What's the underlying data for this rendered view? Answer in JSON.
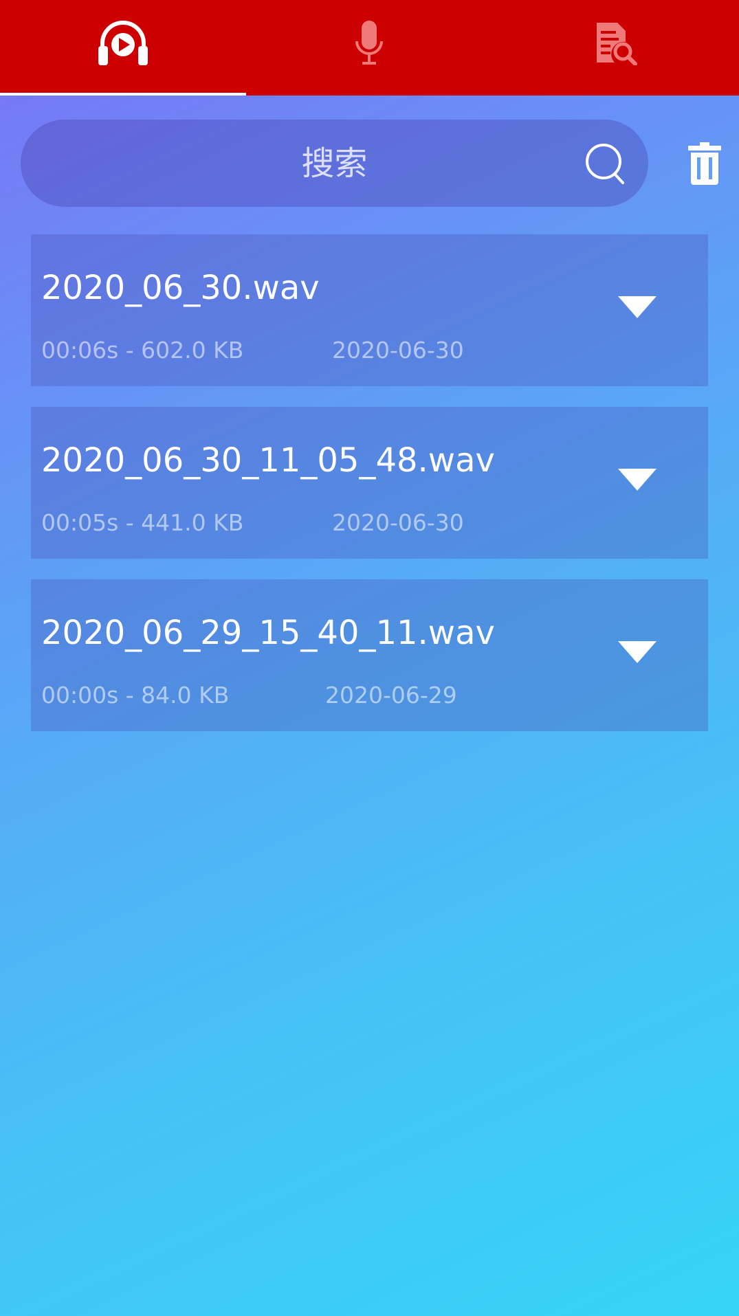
{
  "tabs": [
    {
      "icon": "headphones-play-icon",
      "active": true
    },
    {
      "icon": "microphone-icon",
      "active": false
    },
    {
      "icon": "document-search-icon",
      "active": false
    }
  ],
  "colors": {
    "tabbar": "#cc0001",
    "active_icon": "#ffffff",
    "inactive_icon": "#f07a7a"
  },
  "search": {
    "placeholder": "搜索",
    "value": "",
    "icon": "search-icon"
  },
  "toolbar": {
    "delete_icon": "trash-icon"
  },
  "files": [
    {
      "name": "2020_06_30.wav",
      "meta": "00:06s - 602.0 KB",
      "date": "2020-06-30"
    },
    {
      "name": "2020_06_30_11_05_48.wav",
      "meta": "00:05s - 441.0 KB",
      "date": "2020-06-30"
    },
    {
      "name": "2020_06_29_15_40_11.wav",
      "meta": "00:00s - 84.0 KB",
      "date": "2020-06-29"
    }
  ]
}
